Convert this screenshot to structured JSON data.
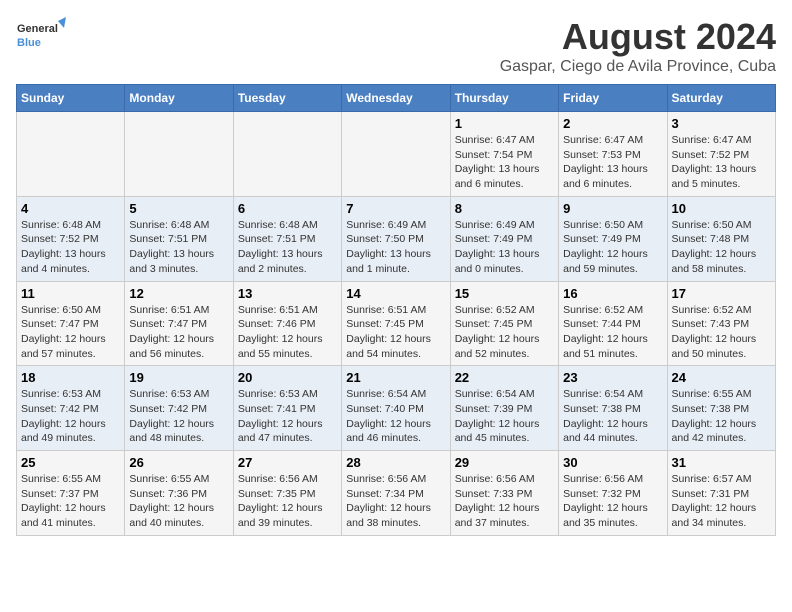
{
  "logo": {
    "line1": "General",
    "line2": "Blue"
  },
  "title": "August 2024",
  "subtitle": "Gaspar, Ciego de Avila Province, Cuba",
  "days_of_week": [
    "Sunday",
    "Monday",
    "Tuesday",
    "Wednesday",
    "Thursday",
    "Friday",
    "Saturday"
  ],
  "weeks": [
    [
      {
        "day": "",
        "info": ""
      },
      {
        "day": "",
        "info": ""
      },
      {
        "day": "",
        "info": ""
      },
      {
        "day": "",
        "info": ""
      },
      {
        "day": "1",
        "info": "Sunrise: 6:47 AM\nSunset: 7:54 PM\nDaylight: 13 hours\nand 6 minutes."
      },
      {
        "day": "2",
        "info": "Sunrise: 6:47 AM\nSunset: 7:53 PM\nDaylight: 13 hours\nand 6 minutes."
      },
      {
        "day": "3",
        "info": "Sunrise: 6:47 AM\nSunset: 7:52 PM\nDaylight: 13 hours\nand 5 minutes."
      }
    ],
    [
      {
        "day": "4",
        "info": "Sunrise: 6:48 AM\nSunset: 7:52 PM\nDaylight: 13 hours\nand 4 minutes."
      },
      {
        "day": "5",
        "info": "Sunrise: 6:48 AM\nSunset: 7:51 PM\nDaylight: 13 hours\nand 3 minutes."
      },
      {
        "day": "6",
        "info": "Sunrise: 6:48 AM\nSunset: 7:51 PM\nDaylight: 13 hours\nand 2 minutes."
      },
      {
        "day": "7",
        "info": "Sunrise: 6:49 AM\nSunset: 7:50 PM\nDaylight: 13 hours\nand 1 minute."
      },
      {
        "day": "8",
        "info": "Sunrise: 6:49 AM\nSunset: 7:49 PM\nDaylight: 13 hours\nand 0 minutes."
      },
      {
        "day": "9",
        "info": "Sunrise: 6:50 AM\nSunset: 7:49 PM\nDaylight: 12 hours\nand 59 minutes."
      },
      {
        "day": "10",
        "info": "Sunrise: 6:50 AM\nSunset: 7:48 PM\nDaylight: 12 hours\nand 58 minutes."
      }
    ],
    [
      {
        "day": "11",
        "info": "Sunrise: 6:50 AM\nSunset: 7:47 PM\nDaylight: 12 hours\nand 57 minutes."
      },
      {
        "day": "12",
        "info": "Sunrise: 6:51 AM\nSunset: 7:47 PM\nDaylight: 12 hours\nand 56 minutes."
      },
      {
        "day": "13",
        "info": "Sunrise: 6:51 AM\nSunset: 7:46 PM\nDaylight: 12 hours\nand 55 minutes."
      },
      {
        "day": "14",
        "info": "Sunrise: 6:51 AM\nSunset: 7:45 PM\nDaylight: 12 hours\nand 54 minutes."
      },
      {
        "day": "15",
        "info": "Sunrise: 6:52 AM\nSunset: 7:45 PM\nDaylight: 12 hours\nand 52 minutes."
      },
      {
        "day": "16",
        "info": "Sunrise: 6:52 AM\nSunset: 7:44 PM\nDaylight: 12 hours\nand 51 minutes."
      },
      {
        "day": "17",
        "info": "Sunrise: 6:52 AM\nSunset: 7:43 PM\nDaylight: 12 hours\nand 50 minutes."
      }
    ],
    [
      {
        "day": "18",
        "info": "Sunrise: 6:53 AM\nSunset: 7:42 PM\nDaylight: 12 hours\nand 49 minutes."
      },
      {
        "day": "19",
        "info": "Sunrise: 6:53 AM\nSunset: 7:42 PM\nDaylight: 12 hours\nand 48 minutes."
      },
      {
        "day": "20",
        "info": "Sunrise: 6:53 AM\nSunset: 7:41 PM\nDaylight: 12 hours\nand 47 minutes."
      },
      {
        "day": "21",
        "info": "Sunrise: 6:54 AM\nSunset: 7:40 PM\nDaylight: 12 hours\nand 46 minutes."
      },
      {
        "day": "22",
        "info": "Sunrise: 6:54 AM\nSunset: 7:39 PM\nDaylight: 12 hours\nand 45 minutes."
      },
      {
        "day": "23",
        "info": "Sunrise: 6:54 AM\nSunset: 7:38 PM\nDaylight: 12 hours\nand 44 minutes."
      },
      {
        "day": "24",
        "info": "Sunrise: 6:55 AM\nSunset: 7:38 PM\nDaylight: 12 hours\nand 42 minutes."
      }
    ],
    [
      {
        "day": "25",
        "info": "Sunrise: 6:55 AM\nSunset: 7:37 PM\nDaylight: 12 hours\nand 41 minutes."
      },
      {
        "day": "26",
        "info": "Sunrise: 6:55 AM\nSunset: 7:36 PM\nDaylight: 12 hours\nand 40 minutes."
      },
      {
        "day": "27",
        "info": "Sunrise: 6:56 AM\nSunset: 7:35 PM\nDaylight: 12 hours\nand 39 minutes."
      },
      {
        "day": "28",
        "info": "Sunrise: 6:56 AM\nSunset: 7:34 PM\nDaylight: 12 hours\nand 38 minutes."
      },
      {
        "day": "29",
        "info": "Sunrise: 6:56 AM\nSunset: 7:33 PM\nDaylight: 12 hours\nand 37 minutes."
      },
      {
        "day": "30",
        "info": "Sunrise: 6:56 AM\nSunset: 7:32 PM\nDaylight: 12 hours\nand 35 minutes."
      },
      {
        "day": "31",
        "info": "Sunrise: 6:57 AM\nSunset: 7:31 PM\nDaylight: 12 hours\nand 34 minutes."
      }
    ]
  ]
}
